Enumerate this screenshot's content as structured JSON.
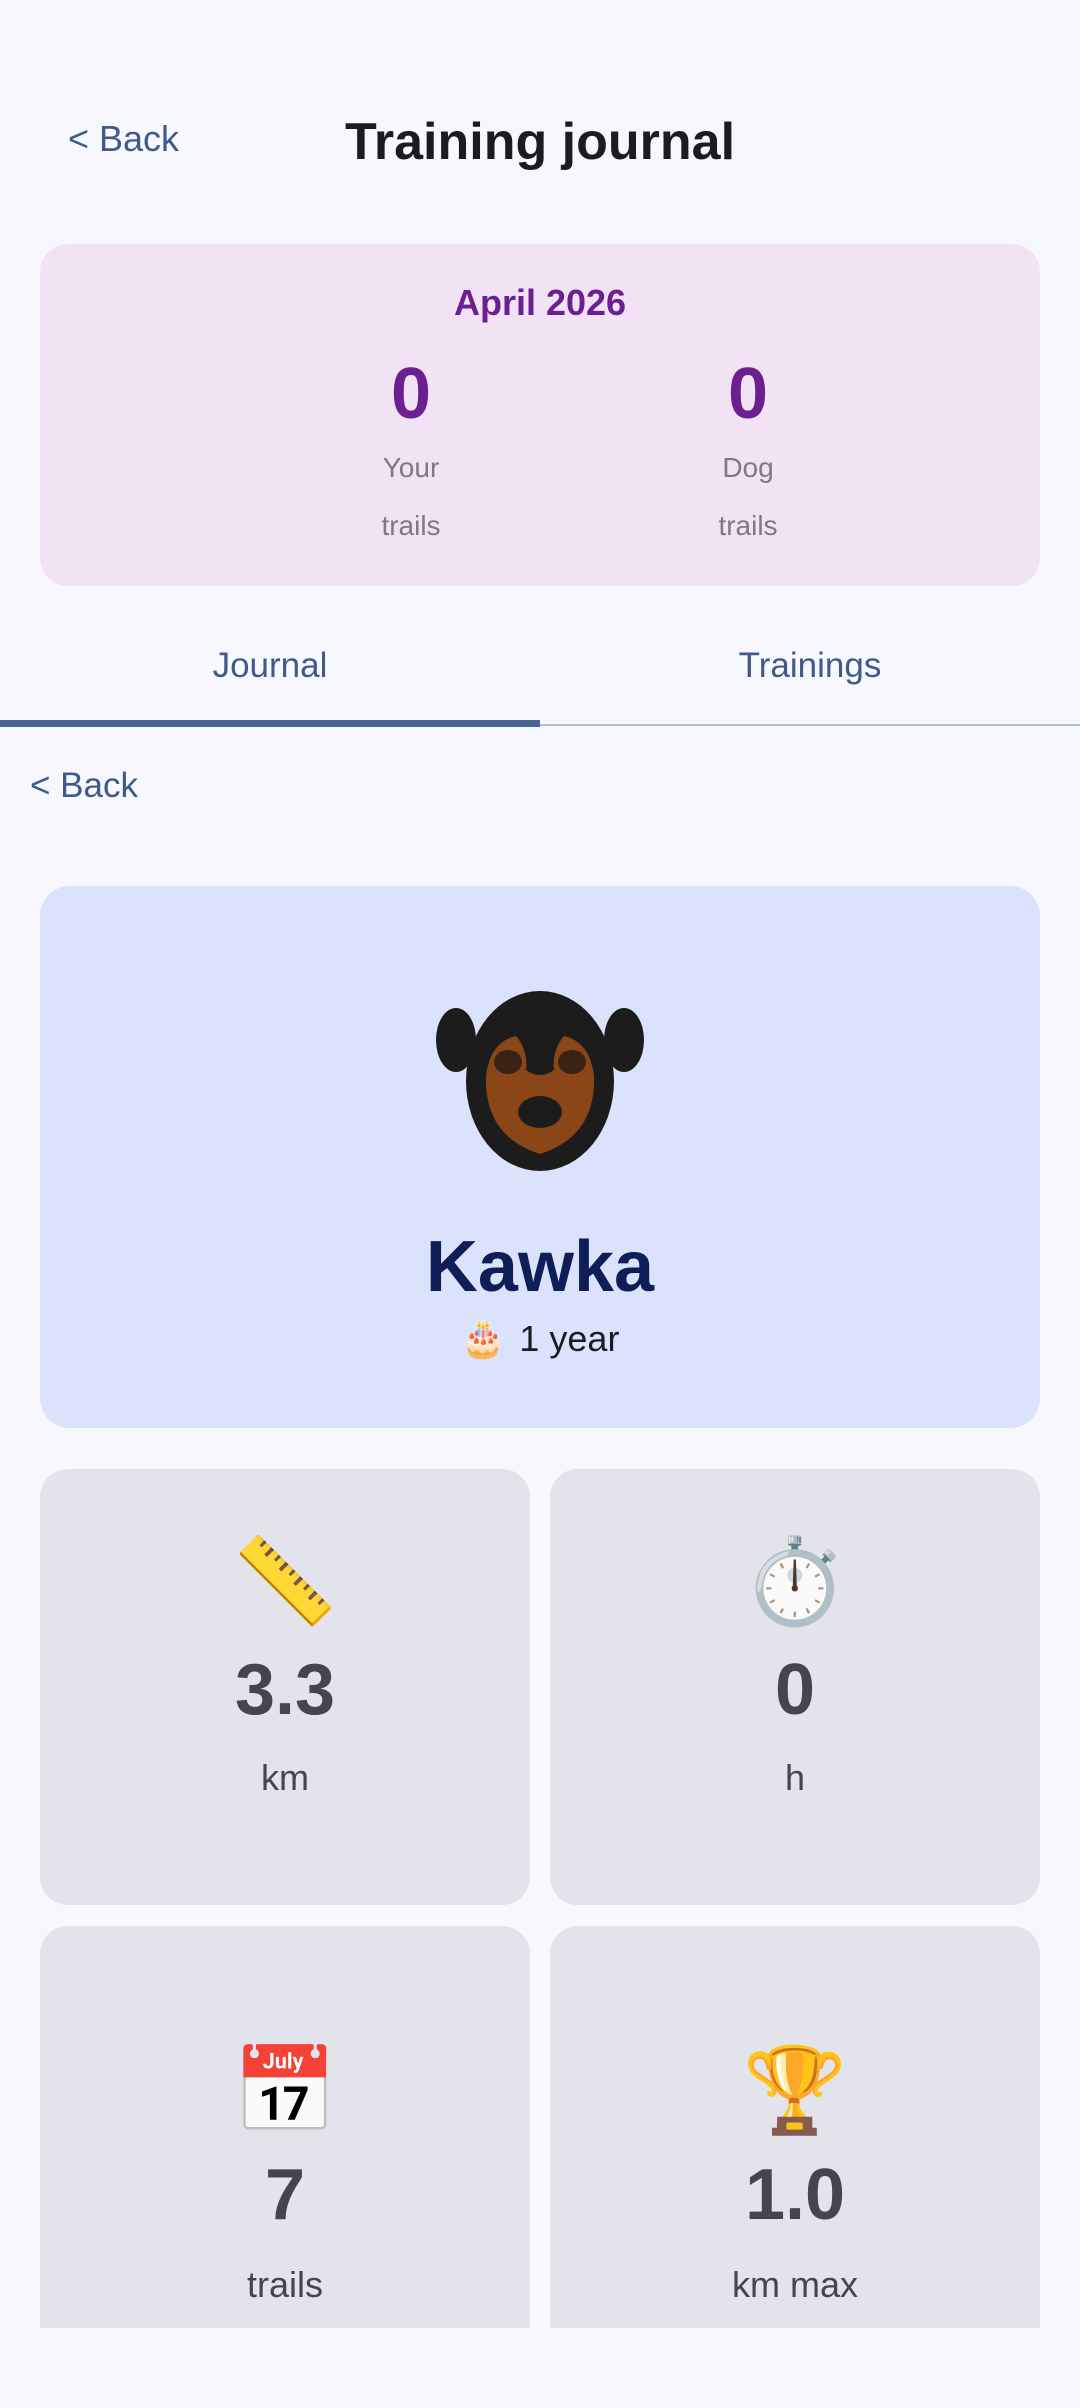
{
  "header": {
    "back_label": "< Back",
    "title": "Training journal"
  },
  "month_summary": {
    "month": "April 2026",
    "your_trails": {
      "value": "0",
      "label_line1": "Your",
      "label_line2": "trails"
    },
    "dog_trails": {
      "value": "0",
      "label_line1": "Dog",
      "label_line2": "trails"
    }
  },
  "tabs": [
    {
      "label": "Journal",
      "active": true
    },
    {
      "label": "Trainings",
      "active": false
    }
  ],
  "inner_back_label": "< Back",
  "profile": {
    "name": "Kawka",
    "age_icon": "birthday-cake-icon",
    "age": "1 year"
  },
  "stats": [
    {
      "icon": "ruler-icon",
      "glyph": "📏",
      "value": "3.3",
      "unit": "km"
    },
    {
      "icon": "stopwatch-icon",
      "glyph": "⏱️",
      "value": "0",
      "unit": "h"
    },
    {
      "icon": "calendar-icon",
      "glyph": "📅",
      "value": "7",
      "unit": "trails"
    },
    {
      "icon": "trophy-icon",
      "glyph": "🏆",
      "value": "1.0",
      "unit": "km max"
    }
  ],
  "colors": {
    "accent": "#3f5a8a",
    "month_card_bg": "#f1e3f3",
    "month_text": "#6c1f91",
    "profile_card_bg": "#dae2fc",
    "dog_name": "#0f1e56",
    "tile_bg": "#e3e3eb"
  }
}
